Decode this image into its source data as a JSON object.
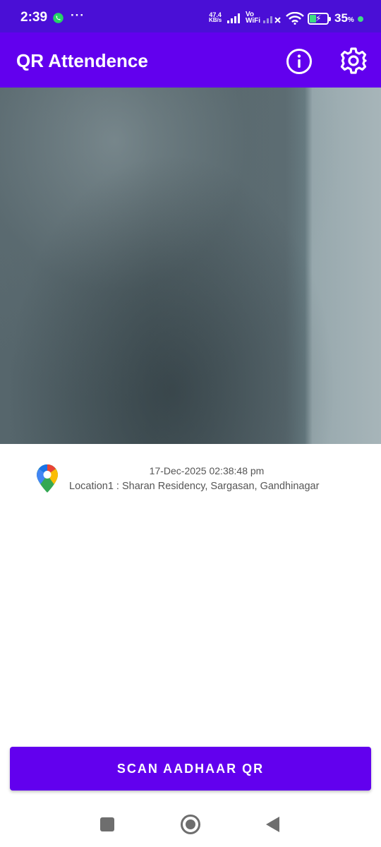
{
  "status_bar": {
    "time": "2:39",
    "more": "···",
    "speed_value": "47.4",
    "speed_unit": "KB/s",
    "vowifi_top": "Vo",
    "vowifi_bottom": "WiFi",
    "battery_percent": "35",
    "battery_unit": "%",
    "icons": [
      "whatsapp-icon",
      "signal-icon",
      "wifi-icon",
      "battery-charging-icon"
    ]
  },
  "app_bar": {
    "title": "QR Attendence",
    "actions": [
      "info-icon",
      "settings-icon"
    ]
  },
  "info": {
    "datetime": "17-Dec-2025 02:38:48 pm",
    "location": "Location1 : Sharan Residency, Sargasan, Gandhinagar",
    "icon": "google-maps-pin-icon"
  },
  "scan_button": {
    "label": "SCAN AADHAAR QR"
  },
  "nav_bar": {
    "buttons": [
      "recent-apps",
      "home",
      "back"
    ]
  },
  "colors": {
    "status_bar": "#4a0fd6",
    "primary": "#6200ee",
    "text_secondary": "#555555"
  }
}
